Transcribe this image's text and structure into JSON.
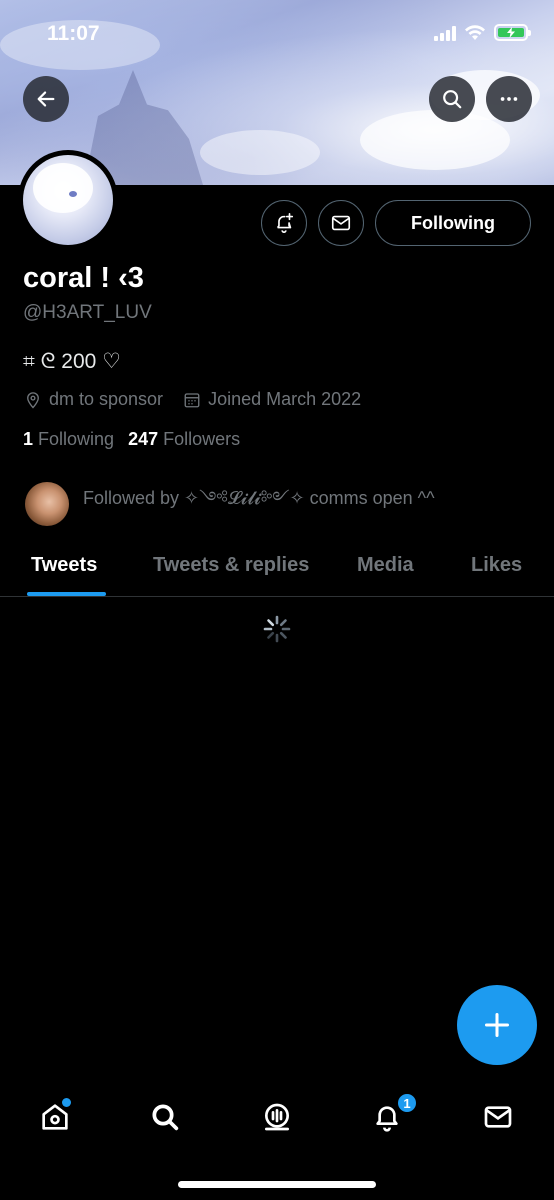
{
  "status_bar": {
    "time": "11:07"
  },
  "profile": {
    "display_name": "coral ! ‹3",
    "handle": "@H3ART_LUV",
    "bio": "⌗ ᘓ 200 ♡",
    "location": "dm to sponsor",
    "joined": "Joined March 2022",
    "following_count": "1",
    "following_label": "Following",
    "followers_count": "247",
    "followers_label": "Followers",
    "followed_by": "Followed by ✧༺𝓛𝓲𝓵𝓲༻✧ comms open ^^"
  },
  "actions": {
    "following_button": "Following"
  },
  "tabs": [
    {
      "label": "Tweets",
      "active": true
    },
    {
      "label": "Tweets & replies",
      "active": false
    },
    {
      "label": "Media",
      "active": false
    },
    {
      "label": "Likes",
      "active": false
    }
  ],
  "bottom_nav": {
    "items": [
      "home-icon",
      "search-icon",
      "spaces-icon",
      "notifications-icon",
      "messages-icon"
    ],
    "notifications_badge": "1"
  },
  "colors": {
    "accent": "#1d9bf0",
    "background": "#000000",
    "muted": "#71767b"
  }
}
